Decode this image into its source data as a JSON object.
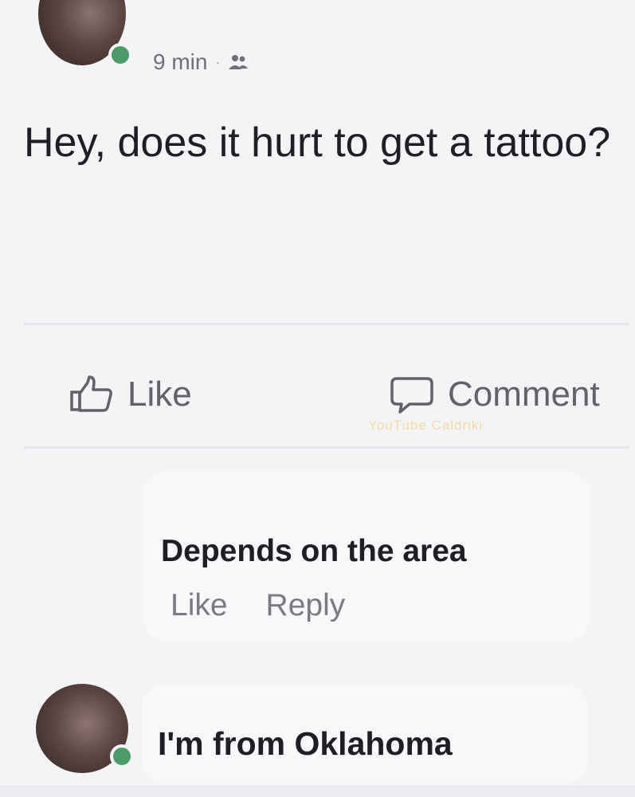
{
  "post": {
    "time": "9 min",
    "separator": "·",
    "audience_icon": "friends-icon",
    "text": "Hey, does it hurt to get a tattoo?"
  },
  "actions": {
    "like_label": "Like",
    "comment_label": "Comment"
  },
  "watermark": "YouTube Caldriki",
  "comments": [
    {
      "text": "Depends on the area",
      "like_label": "Like",
      "reply_label": "Reply"
    },
    {
      "text": "I'm from Oklahoma"
    }
  ],
  "colors": {
    "background": "#f4f3f6",
    "online": "#4c9a6a",
    "muted": "#62636a"
  }
}
